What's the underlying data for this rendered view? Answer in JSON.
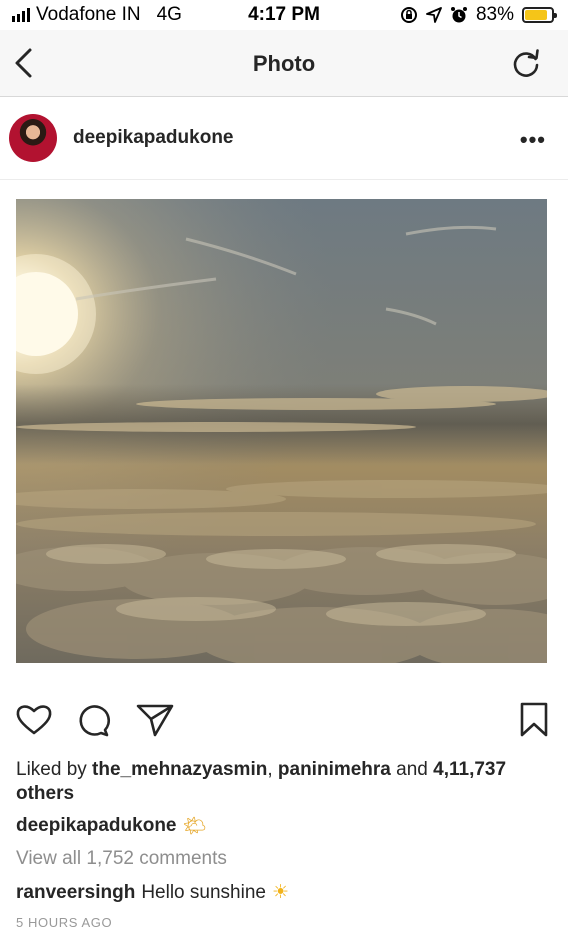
{
  "status": {
    "carrier": "Vodafone IN",
    "network": "4G",
    "time": "4:17 PM",
    "battery_percent": "83%",
    "battery_level": 0.83,
    "battery_color": "#f5c518"
  },
  "nav": {
    "title": "Photo",
    "back_icon": "chevron-left-icon",
    "refresh_icon": "refresh-icon"
  },
  "post": {
    "username": "deepikapadukone",
    "more_label": "•••",
    "likes_prefix": "Liked by ",
    "liker_1": "the_mehnazyasmin",
    "separator": ", ",
    "liker_2": "paninimehra",
    "and_text": " and ",
    "likes_count": "4,11,737 others",
    "caption_user": "deepikapadukone",
    "caption_emoji": "🌤",
    "view_comments": "View all 1,752 comments",
    "comment_user": "ranveersingh",
    "comment_text": "Hello sunshine",
    "comment_emoji": "☀",
    "timestamp": "5 HOURS AGO"
  },
  "actions": {
    "like_icon": "heart-icon",
    "comment_icon": "comment-icon",
    "share_icon": "send-icon",
    "save_icon": "bookmark-icon"
  }
}
